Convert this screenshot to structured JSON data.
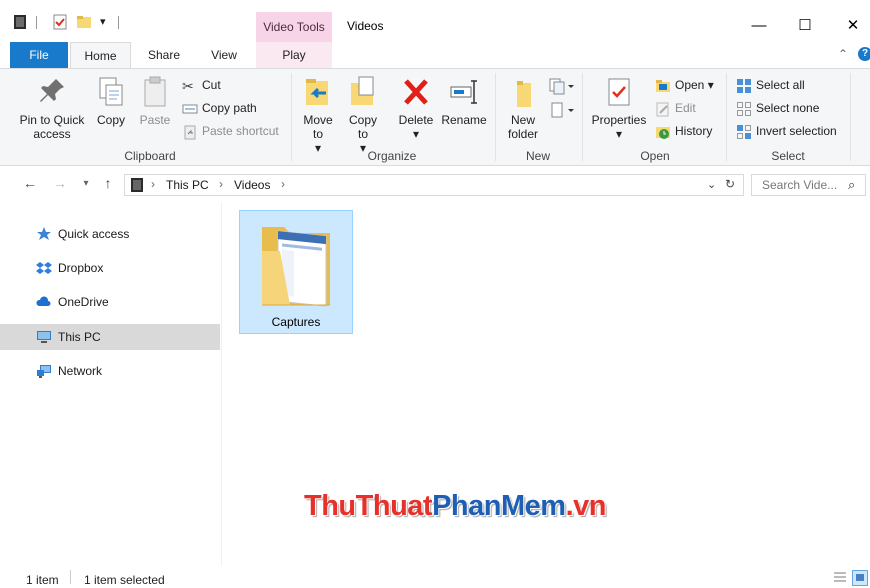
{
  "window": {
    "title": "Videos",
    "context_tab": "Video Tools",
    "controls": {
      "minimize": "—",
      "maximize": "☐",
      "close": "✕"
    }
  },
  "ribbon_tabs": [
    "File",
    "Home",
    "Share",
    "View",
    "Play"
  ],
  "ribbon": {
    "clipboard": {
      "label": "Clipboard",
      "pin_label": "Pin to Quick access",
      "copy_label": "Copy",
      "paste_label": "Paste",
      "cut_label": "Cut",
      "copy_path_label": "Copy path",
      "paste_shortcut_label": "Paste shortcut"
    },
    "organize": {
      "label": "Organize",
      "move_to_label": "Move to",
      "copy_to_label": "Copy to",
      "delete_label": "Delete",
      "rename_label": "Rename"
    },
    "new": {
      "label": "New",
      "new_folder_label": "New folder"
    },
    "open": {
      "label": "Open",
      "properties_label": "Properties",
      "open_label": "Open",
      "edit_label": "Edit",
      "history_label": "History"
    },
    "select": {
      "label": "Select",
      "select_all_label": "Select all",
      "select_none_label": "Select none",
      "invert_label": "Invert selection"
    }
  },
  "address": {
    "crumbs": [
      "This PC",
      "Videos"
    ],
    "search_placeholder": "Search Vide..."
  },
  "nav_pane": {
    "items": [
      {
        "label": "Quick access"
      },
      {
        "label": "Dropbox"
      },
      {
        "label": "OneDrive"
      },
      {
        "label": "This PC"
      },
      {
        "label": "Network"
      }
    ]
  },
  "content": {
    "items": [
      {
        "name": "Captures"
      }
    ]
  },
  "status": {
    "count": "1 item",
    "selected": "1 item selected"
  },
  "watermark": {
    "part1": "ThuThuat",
    "part2": "PhanMem",
    "part3": ".vn"
  },
  "colors": {
    "accent": "#1979ca",
    "selected_bg": "#cce8ff",
    "context_tab": "#f7d4e8"
  }
}
